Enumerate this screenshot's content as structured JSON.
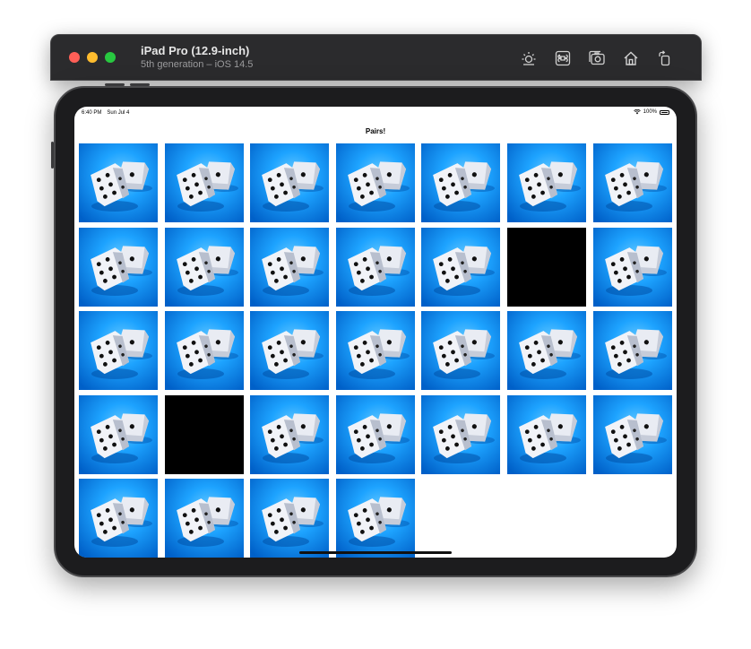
{
  "simulator": {
    "title": "iPad Pro (12.9-inch)",
    "subtitle": "5th generation – iOS 14.5",
    "toolbar": [
      {
        "name": "brightness-icon"
      },
      {
        "name": "command-key-icon"
      },
      {
        "name": "screenshot-icon"
      },
      {
        "name": "home-icon"
      },
      {
        "name": "rotate-icon"
      }
    ]
  },
  "status_bar": {
    "time": "6:40 PM",
    "date": "Sun Jul 4",
    "battery": "100%"
  },
  "nav": {
    "title": "Pairs!"
  },
  "colors": {
    "card_blue": "#1aa0ff",
    "matched": "#000000"
  },
  "cards": [
    "face-down",
    "face-down",
    "face-down",
    "face-down",
    "face-down",
    "face-down",
    "face-down",
    "face-down",
    "face-down",
    "face-down",
    "face-down",
    "face-down",
    "matched",
    "face-down",
    "face-down",
    "face-down",
    "face-down",
    "face-down",
    "face-down",
    "face-down",
    "face-down",
    "face-down",
    "matched",
    "face-down",
    "face-down",
    "face-down",
    "face-down",
    "face-down",
    "face-down",
    "face-down",
    "face-down",
    "face-down"
  ]
}
